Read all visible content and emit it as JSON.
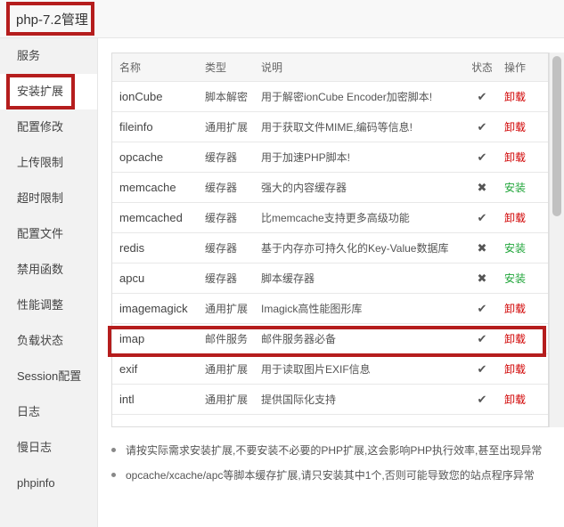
{
  "window": {
    "title": "php-7.2管理"
  },
  "sidebar": {
    "items": [
      {
        "label": "服务"
      },
      {
        "label": "安装扩展"
      },
      {
        "label": "配置修改"
      },
      {
        "label": "上传限制"
      },
      {
        "label": "超时限制"
      },
      {
        "label": "配置文件"
      },
      {
        "label": "禁用函数"
      },
      {
        "label": "性能调整"
      },
      {
        "label": "负载状态"
      },
      {
        "label": "Session配置"
      },
      {
        "label": "日志"
      },
      {
        "label": "慢日志"
      },
      {
        "label": "phpinfo"
      }
    ],
    "active": "安装扩展"
  },
  "table": {
    "headers": {
      "name": "名称",
      "type": "类型",
      "desc": "说明",
      "status": "状态",
      "op": "操作"
    },
    "rows": [
      {
        "name": "ionCube",
        "type": "脚本解密",
        "desc": "用于解密ionCube Encoder加密脚本!",
        "status": "✔",
        "op": "卸载"
      },
      {
        "name": "fileinfo",
        "type": "通用扩展",
        "desc": "用于获取文件MIME,编码等信息!",
        "status": "✔",
        "op": "卸载"
      },
      {
        "name": "opcache",
        "type": "缓存器",
        "desc": "用于加速PHP脚本!",
        "status": "✔",
        "op": "卸载"
      },
      {
        "name": "memcache",
        "type": "缓存器",
        "desc": "强大的内容缓存器",
        "status": "✖",
        "op": "安装"
      },
      {
        "name": "memcached",
        "type": "缓存器",
        "desc": "比memcache支持更多高级功能",
        "status": "✔",
        "op": "卸载"
      },
      {
        "name": "redis",
        "type": "缓存器",
        "desc": "基于内存亦可持久化的Key-Value数据库",
        "status": "✖",
        "op": "安装"
      },
      {
        "name": "apcu",
        "type": "缓存器",
        "desc": "脚本缓存器",
        "status": "✖",
        "op": "安装"
      },
      {
        "name": "imagemagick",
        "type": "通用扩展",
        "desc": "Imagick高性能图形库",
        "status": "✔",
        "op": "卸载"
      },
      {
        "name": "imap",
        "type": "邮件服务",
        "desc": "邮件服务器必备",
        "status": "✔",
        "op": "卸载"
      },
      {
        "name": "exif",
        "type": "通用扩展",
        "desc": "用于读取图片EXIF信息",
        "status": "✔",
        "op": "卸载"
      },
      {
        "name": "intl",
        "type": "通用扩展",
        "desc": "提供国际化支持",
        "status": "✔",
        "op": "卸载"
      }
    ]
  },
  "notes": [
    "请按实际需求安装扩展,不要安装不必要的PHP扩展,这会影响PHP执行效率,甚至出现异常",
    "opcache/xcache/apc等脚本缓存扩展,请只安装其中1个,否则可能导致您的站点程序异常"
  ],
  "colors": {
    "highlight": "#b51d1d",
    "uninstall": "#d00000",
    "install": "#20a53a"
  },
  "icons": {
    "installed": "check-icon",
    "not_installed": "cross-icon"
  }
}
